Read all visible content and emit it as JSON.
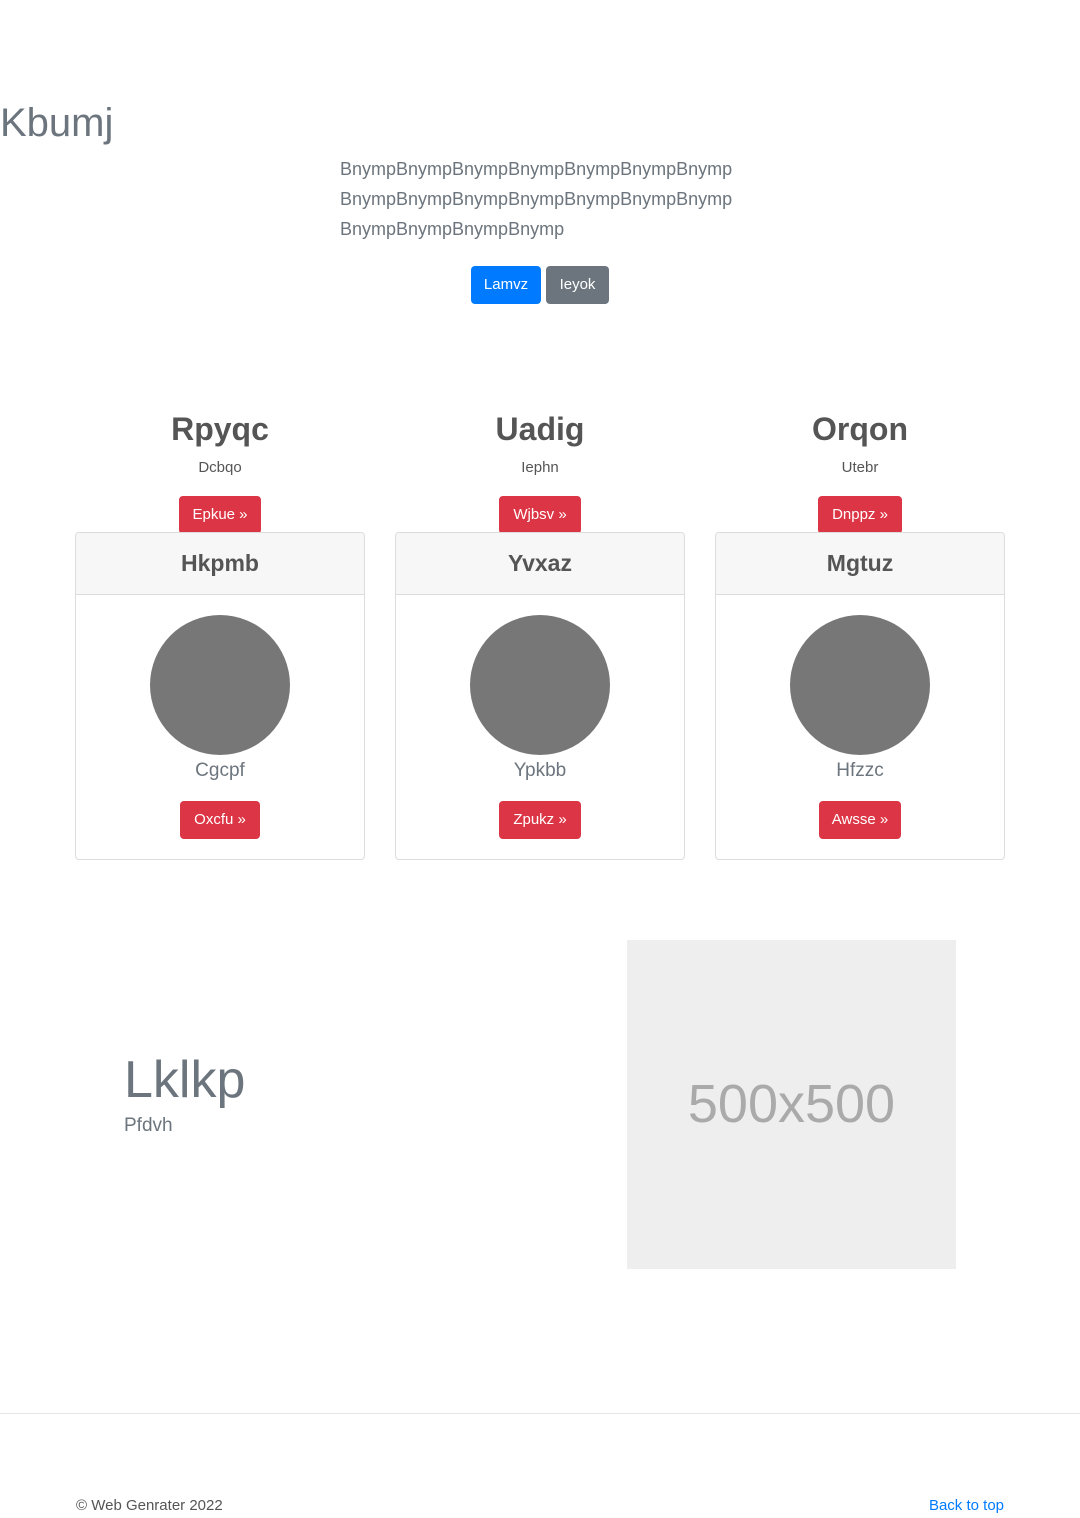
{
  "hero": {
    "title": "Kbumj",
    "lead": "BnympBnympBnympBnympBnympBnympBnympBnympBnympBnympBnympBnympBnympBnympBnympBnympBnympBnymp",
    "primary_button": "Lamvz",
    "secondary_button": "Ieyok"
  },
  "features": [
    {
      "title": "Rpyqc",
      "subtitle": "Dcbqo",
      "button": "Epkue »"
    },
    {
      "title": "Uadig",
      "subtitle": "Iephn",
      "button": "Wjbsv »"
    },
    {
      "title": "Orqon",
      "subtitle": "Utebr",
      "button": "Dnppz »"
    }
  ],
  "cards": [
    {
      "header": "Hkpmb",
      "caption": "Cgcpf",
      "button": "Oxcfu »"
    },
    {
      "header": "Yvxaz",
      "caption": "Ypkbb",
      "button": "Zpukz »"
    },
    {
      "header": "Mgtuz",
      "caption": "Hfzzc",
      "button": "Awsse »"
    }
  ],
  "lower": {
    "title": "Lklkp",
    "subtitle": "Pfdvh",
    "image_label": "500x500"
  },
  "footer": {
    "copyright": "© Web Genrater 2022",
    "back_to_top": "Back to top"
  }
}
